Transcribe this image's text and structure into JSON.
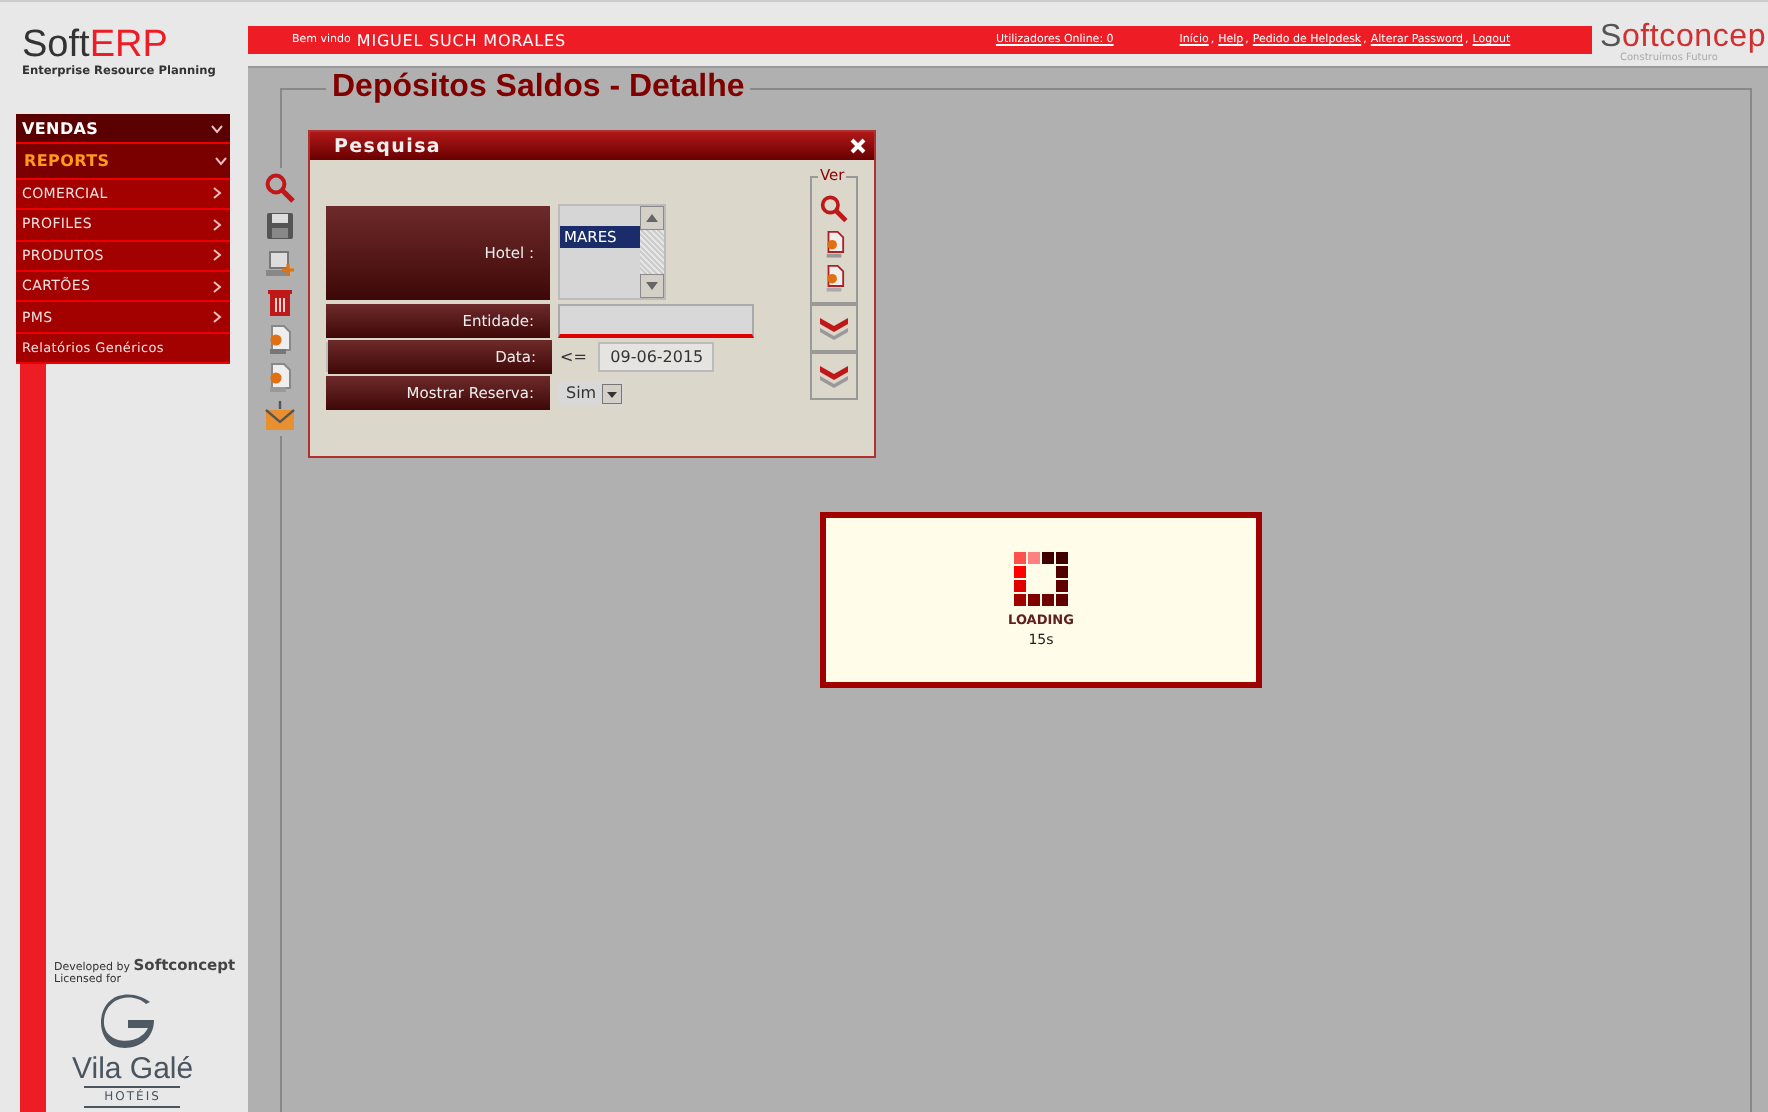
{
  "logo": {
    "soft": "Soft",
    "erp": "ERP",
    "subtitle": "Enterprise Resource Planning"
  },
  "menu": [
    {
      "label": "VENDAS",
      "kind": "section",
      "expanded": true,
      "selected": false
    },
    {
      "label": "REPORTS",
      "kind": "section",
      "expanded": true,
      "selected": true
    },
    {
      "label": "COMERCIAL",
      "kind": "item",
      "expanded": false,
      "selected": false
    },
    {
      "label": "PROFILES",
      "kind": "item",
      "expanded": false,
      "selected": false
    },
    {
      "label": "PRODUTOS",
      "kind": "item",
      "expanded": false,
      "selected": false
    },
    {
      "label": "CARTÕES",
      "kind": "item",
      "expanded": false,
      "selected": false
    },
    {
      "label": "PMS",
      "kind": "item",
      "expanded": false,
      "selected": false
    },
    {
      "label": "Relatórios Genéricos",
      "kind": "link",
      "selected": false
    }
  ],
  "footer": {
    "developed_by": "Developed by",
    "developer": "Softconcept",
    "licensed_for": "Licensed for",
    "client": "Vila Galé",
    "client_sub": "HOTÉIS"
  },
  "top_bar": {
    "welcome": "Bem vindo",
    "user": "MIGUEL SUCH MORALES",
    "online": "Utilizadores Online: 0",
    "links": [
      "Início",
      "Help",
      "Pedido de Helpdesk",
      "Alterar Password",
      "Logout"
    ],
    "link_separator": ",",
    "brand_s": "S",
    "brand": "oftconcep",
    "tagline": "Construímos Futuro"
  },
  "page": {
    "title": "Depósitos Saldos - Detalhe"
  },
  "dialog": {
    "title": "Pesquisa",
    "fields": [
      {
        "label": "Hotel :",
        "kind": "list",
        "options": [
          {
            "label": "MARES",
            "selected": true
          }
        ]
      },
      {
        "label": "Entidade:",
        "kind": "input"
      },
      {
        "label": "Data:",
        "kind": "date",
        "operator": "<=",
        "value": "09-06-2015"
      },
      {
        "label": "Mostrar Reserva:",
        "kind": "select",
        "value": "Sim"
      }
    ],
    "ver_label": "Ver"
  },
  "loading": {
    "label": "LOADING",
    "time": "15s"
  }
}
